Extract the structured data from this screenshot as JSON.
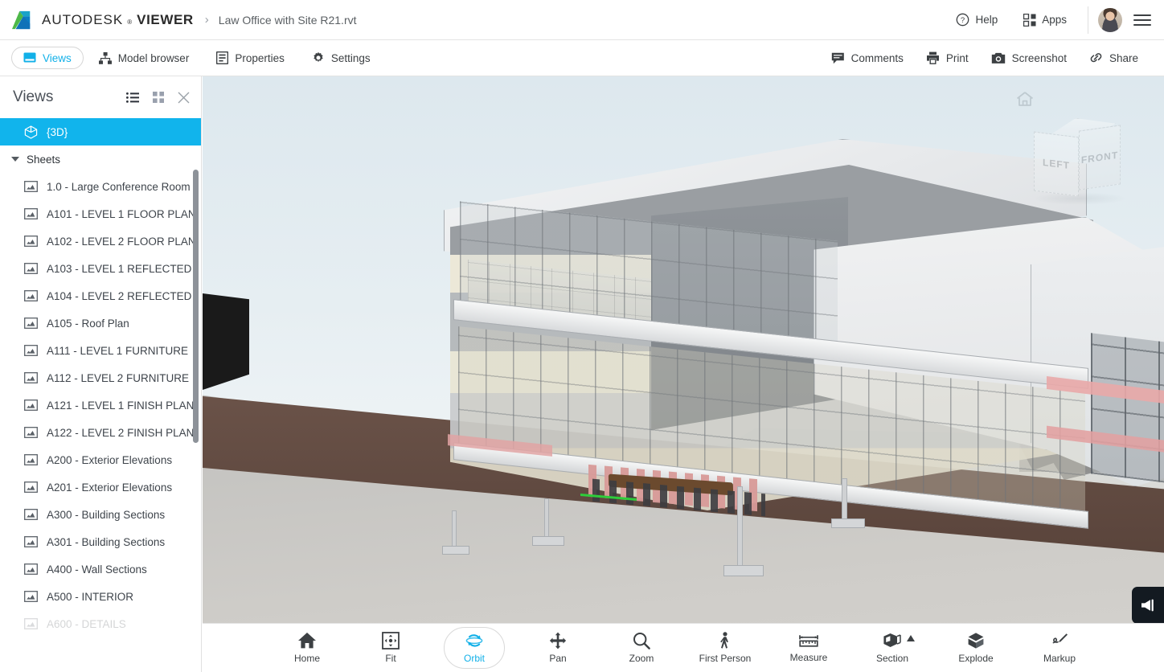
{
  "header": {
    "brand_light": "AUTODESK",
    "brand_reg": "®",
    "brand_bold": "VIEWER",
    "separator": "›",
    "document_title": "Law Office with Site R21.rvt",
    "actions": [
      {
        "id": "help",
        "label": "Help",
        "icon": "help-circle-icon"
      },
      {
        "id": "apps",
        "label": "Apps",
        "icon": "apps-grid-icon"
      }
    ],
    "avatar_alt": "User avatar",
    "menu_icon": "hamburger-menu-icon"
  },
  "toolbar": {
    "left": [
      {
        "id": "views",
        "label": "Views",
        "icon": "views-panel-icon",
        "active": true
      },
      {
        "id": "model-browser",
        "label": "Model browser",
        "icon": "model-tree-icon",
        "active": false
      },
      {
        "id": "properties",
        "label": "Properties",
        "icon": "properties-list-icon",
        "active": false
      },
      {
        "id": "settings",
        "label": "Settings",
        "icon": "gear-icon",
        "active": false
      }
    ],
    "right": [
      {
        "id": "comments",
        "label": "Comments",
        "icon": "comment-bubble-icon"
      },
      {
        "id": "print",
        "label": "Print",
        "icon": "printer-icon"
      },
      {
        "id": "screenshot",
        "label": "Screenshot",
        "icon": "camera-icon"
      },
      {
        "id": "share",
        "label": "Share",
        "icon": "link-chain-icon"
      }
    ]
  },
  "sidebar": {
    "title": "Views",
    "header_icons": [
      {
        "id": "list-view",
        "icon": "list-view-icon",
        "active": true
      },
      {
        "id": "grid-view",
        "icon": "grid-view-icon",
        "active": false
      },
      {
        "id": "close-panel",
        "icon": "close-icon",
        "active": false
      }
    ],
    "selected_view": {
      "label": "{3D}",
      "icon": "cube-3d-icon"
    },
    "group": {
      "label": "Sheets",
      "expanded": true
    },
    "sheets": [
      {
        "label": "1.0 - Large Conference Room"
      },
      {
        "label": "A101 - LEVEL 1 FLOOR PLAN"
      },
      {
        "label": "A102 - LEVEL 2 FLOOR PLAN"
      },
      {
        "label": "A103 - LEVEL 1 REFLECTED"
      },
      {
        "label": "A104 - LEVEL 2 REFLECTED"
      },
      {
        "label": "A105 - Roof Plan"
      },
      {
        "label": "A111 - LEVEL 1 FURNITURE"
      },
      {
        "label": "A112 - LEVEL 2 FURNITURE"
      },
      {
        "label": "A121 - LEVEL 1 FINISH PLAN"
      },
      {
        "label": "A122 - LEVEL 2 FINISH PLAN"
      },
      {
        "label": "A200 - Exterior Elevations"
      },
      {
        "label": "A201 - Exterior Elevations"
      },
      {
        "label": "A300 - Building Sections"
      },
      {
        "label": "A301 - Building Sections"
      },
      {
        "label": "A400 - Wall Sections"
      },
      {
        "label": "A500 - INTERIOR"
      },
      {
        "label": "A600 - DETAILS"
      }
    ]
  },
  "viewport": {
    "viewcube": {
      "face_left": "LEFT",
      "face_front": "FRONT",
      "home_icon": "home-icon"
    },
    "announcement_icon": "megaphone-icon"
  },
  "bottombar": {
    "tools": [
      {
        "id": "home",
        "label": "Home",
        "icon": "home-icon",
        "active": false,
        "dropdown": false
      },
      {
        "id": "fit",
        "label": "Fit",
        "icon": "fit-to-view-icon",
        "active": false,
        "dropdown": false
      },
      {
        "id": "orbit",
        "label": "Orbit",
        "icon": "orbit-icon",
        "active": true,
        "dropdown": false
      },
      {
        "id": "pan",
        "label": "Pan",
        "icon": "pan-arrows-icon",
        "active": false,
        "dropdown": false
      },
      {
        "id": "zoom",
        "label": "Zoom",
        "icon": "magnifier-icon",
        "active": false,
        "dropdown": false
      },
      {
        "id": "first-person",
        "label": "First Person",
        "icon": "person-walk-icon",
        "active": false,
        "dropdown": false
      },
      {
        "id": "measure",
        "label": "Measure",
        "icon": "ruler-icon",
        "active": false,
        "dropdown": false
      },
      {
        "id": "section",
        "label": "Section",
        "icon": "section-box-icon",
        "active": false,
        "dropdown": true
      },
      {
        "id": "explode",
        "label": "Explode",
        "icon": "explode-cube-icon",
        "active": false,
        "dropdown": false
      },
      {
        "id": "markup",
        "label": "Markup",
        "icon": "pencil-markup-icon",
        "active": false,
        "dropdown": false
      }
    ]
  },
  "colors": {
    "accent": "#11b4ec",
    "text": "#3c4043",
    "sky_top": "#dde8ee",
    "earth": "#5c463d",
    "pink_band": "#e3a5a5"
  }
}
